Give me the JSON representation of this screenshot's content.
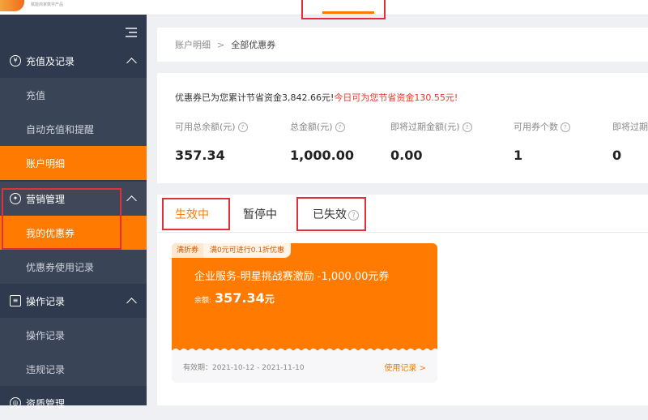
{
  "header": {
    "logo_text": "赋能商家数字产品"
  },
  "sidebar": {
    "groups": [
      {
        "label": "充值及记录",
        "items": [
          "充值",
          "自动充值和提醒",
          "账户明细"
        ]
      },
      {
        "label": "营销管理",
        "items": [
          "我的优惠券",
          "优惠券使用记录"
        ]
      },
      {
        "label": "操作记录",
        "items": [
          "操作记录",
          "违规记录"
        ]
      },
      {
        "label": "资质管理"
      }
    ],
    "active_item": "我的优惠券"
  },
  "breadcrumb": {
    "parent": "账户明细",
    "separator": ">",
    "current": "全部优惠券"
  },
  "summary": {
    "notice_prefix": "优惠券已为您累计节省资金3,842.66元!",
    "notice_highlight": "今日可为您节省资金130.55元!",
    "metrics": [
      {
        "label": "可用总余额(元)",
        "value": "357.34"
      },
      {
        "label": "总金额(元)",
        "value": "1,000.00"
      },
      {
        "label": "即将过期金额(元)",
        "value": "0.00"
      },
      {
        "label": "可用券个数",
        "value": "1"
      },
      {
        "label": "即将过期",
        "value": "0"
      }
    ]
  },
  "tabs": [
    {
      "label": "生效中",
      "active": true
    },
    {
      "label": "暂停中",
      "active": false
    },
    {
      "label": "已失效",
      "active": false
    }
  ],
  "coupon": {
    "type_badge": "满折券",
    "rule": "满0元可进行0.1折优惠",
    "title": "企业服务-明星挑战赛激励 -1,000.00元券",
    "balance_label": "余额:",
    "balance_value": "357.34",
    "balance_unit": "元",
    "validity": "有效期：2021-10-12 - 2021-11-10",
    "usage_link": "使用记录 >"
  },
  "colors": {
    "accent": "#ff7a00",
    "sidebar_bg": "#2f3a4e",
    "annotation_red": "#e0303b"
  }
}
